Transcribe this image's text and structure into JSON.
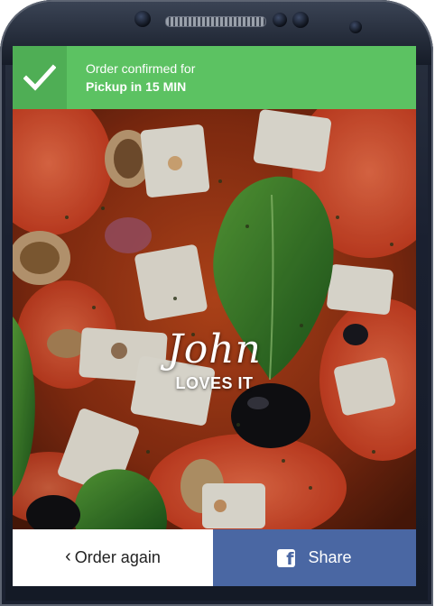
{
  "banner": {
    "line1": "Order confirmed for",
    "line2": "Pickup in 15 MIN",
    "icon": "checkmark-icon",
    "bg_color": "#5cc262"
  },
  "hero": {
    "image": "pizza-photo",
    "name": "John",
    "tagline": "LOVES IT"
  },
  "actions": {
    "order_again_label": "Order again",
    "order_again_icon": "chevron-left-icon",
    "share_label": "Share",
    "share_icon": "facebook-icon",
    "share_color": "#4a67a3"
  }
}
